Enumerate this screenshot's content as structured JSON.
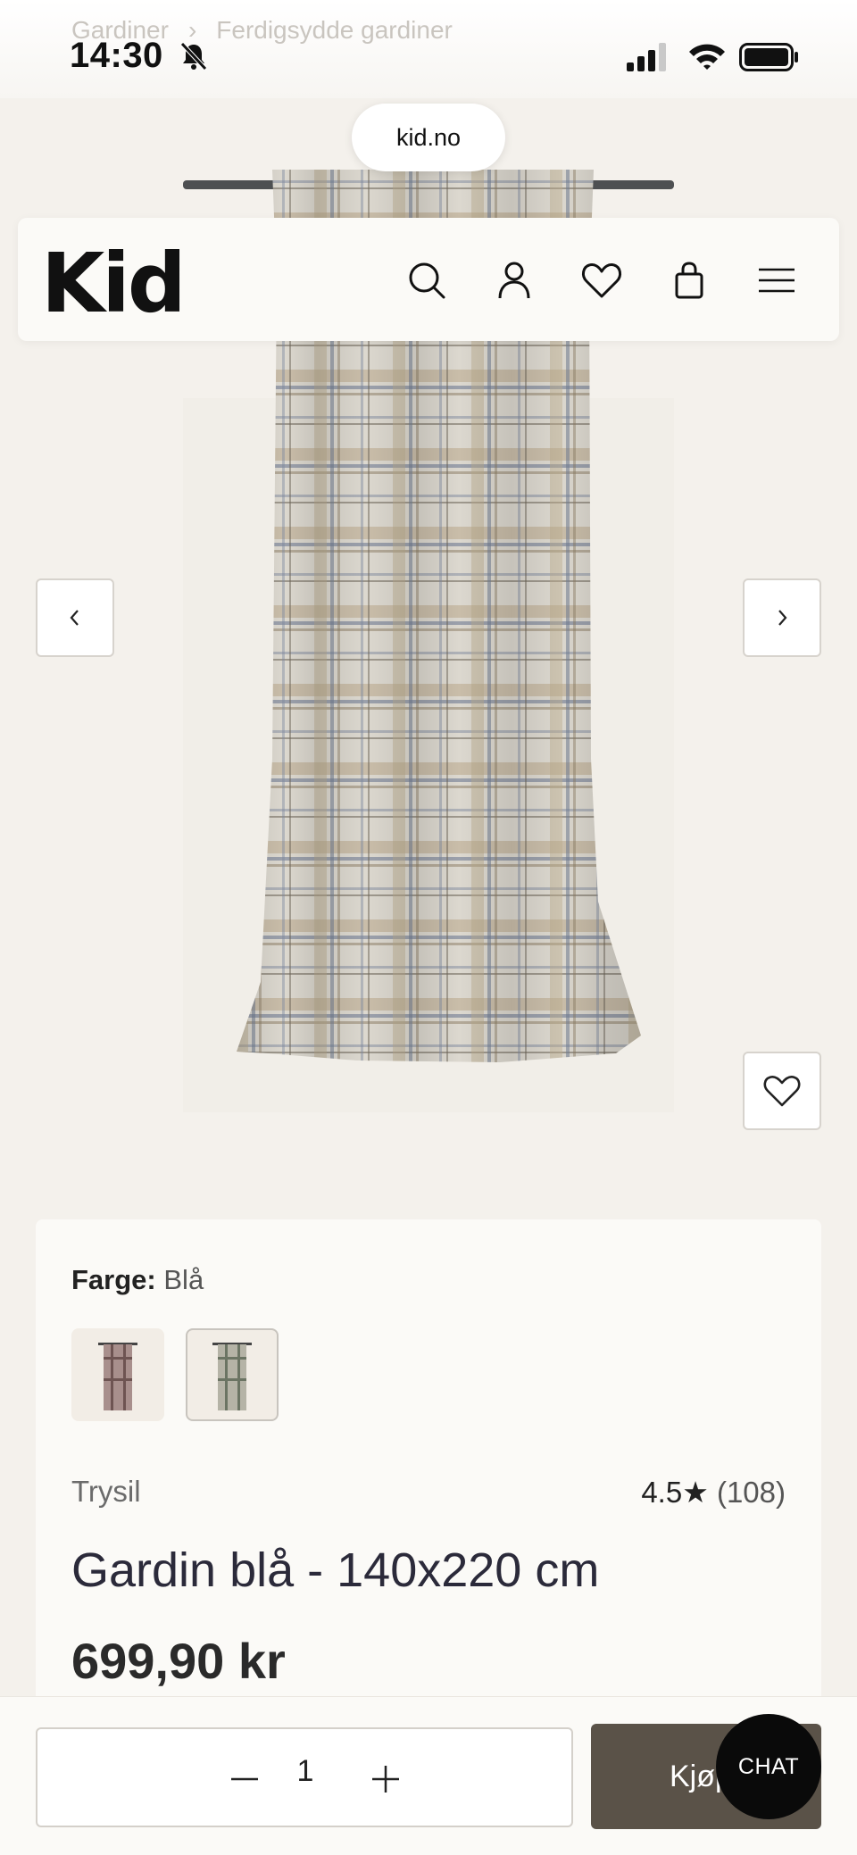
{
  "status_bar": {
    "time": "14:30",
    "breadcrumb": [
      "Gardiner",
      "Ferdigsydde gardiner"
    ]
  },
  "browser": {
    "url": "kid.no"
  },
  "header": {
    "logo": "Kid",
    "icons": [
      "search-icon",
      "account-icon",
      "heart-icon",
      "bag-icon",
      "menu-icon"
    ]
  },
  "gallery": {
    "prev_icon": "chevron-left-icon",
    "next_icon": "chevron-right-icon",
    "favorite_icon": "heart-icon"
  },
  "product": {
    "color_label": "Farge:",
    "color_value": "Blå",
    "brand": "Trysil",
    "rating": "4.5",
    "rating_star": "★",
    "review_count": "(108)",
    "title": "Gardin blå - 140x220 cm",
    "price": "699,90 kr"
  },
  "cart": {
    "quantity": "1",
    "buy_label": "Kjøp",
    "chat_label": "CHAT"
  },
  "colors": {
    "buy_button": "#5a5248",
    "chat_button": "#0a0a0a",
    "page_bg": "#f4f1ec"
  }
}
